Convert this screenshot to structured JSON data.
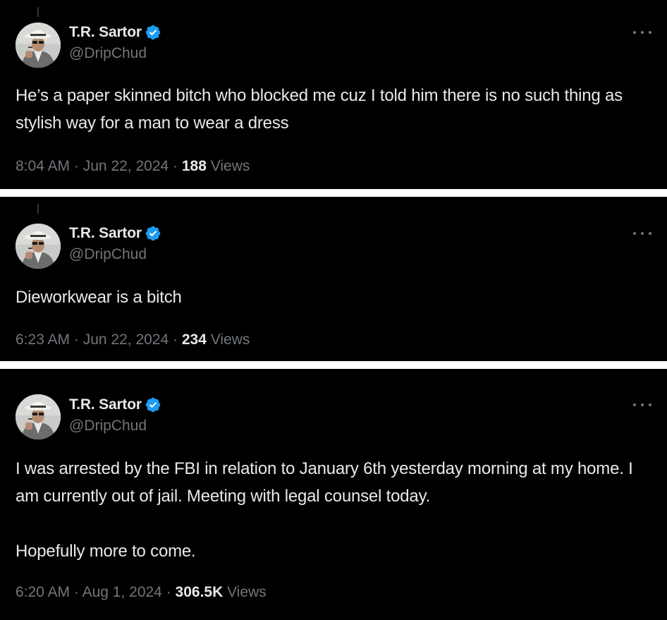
{
  "tweets": [
    {
      "display_name": "T.R. Sartor",
      "handle": "@DripChud",
      "text": "He’s a paper skinned bitch who blocked me cuz I told him there is no such thing as stylish way for a man to wear a dress",
      "time": "8:04 AM",
      "sep1": "·",
      "date": "Jun 22, 2024",
      "sep2": "·",
      "views_count": "188",
      "views_label": "Views"
    },
    {
      "display_name": "T.R. Sartor",
      "handle": "@DripChud",
      "text": "Dieworkwear is a bitch",
      "time": "6:23 AM",
      "sep1": "·",
      "date": "Jun 22, 2024",
      "sep2": "·",
      "views_count": "234",
      "views_label": "Views"
    },
    {
      "display_name": "T.R. Sartor",
      "handle": "@DripChud",
      "text": "I was arrested by the FBI in relation to January 6th yesterday morning at my home. I am currently out of jail. Meeting with legal counsel today.\n\nHopefully more to come.",
      "time": "6:20 AM",
      "sep1": "·",
      "date": "Aug 1, 2024",
      "sep2": "·",
      "views_count": "306.5K",
      "views_label": "Views"
    }
  ],
  "icons": {
    "verified": "verified-badge-icon",
    "more": "more-options-icon"
  },
  "colors": {
    "background": "#000000",
    "separator": "#ffffff",
    "primary_text": "#e7e9ea",
    "secondary_text": "#71767b",
    "verified_blue": "#1d9bf0"
  }
}
